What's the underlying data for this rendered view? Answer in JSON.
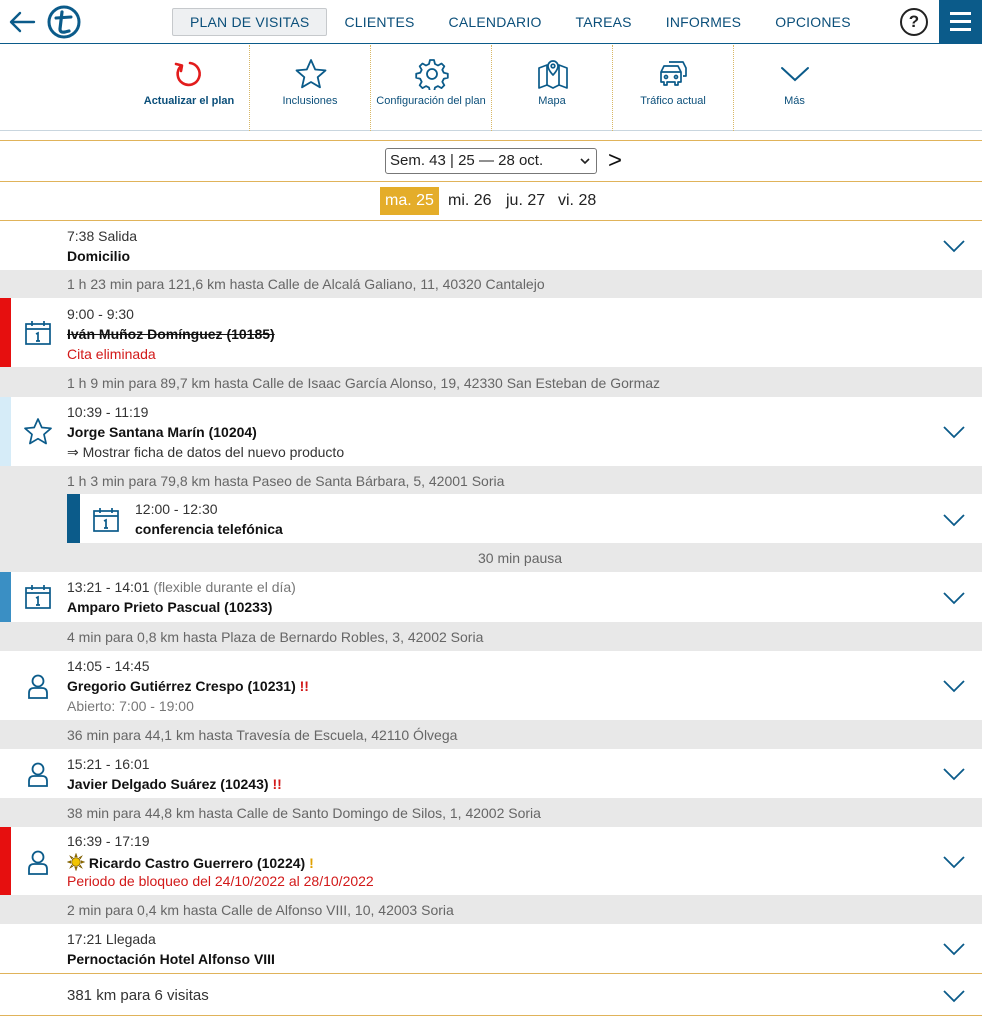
{
  "nav": {
    "items": [
      "PLAN DE VISITAS",
      "CLIENTES",
      "CALENDARIO",
      "TAREAS",
      "INFORMES",
      "OPCIONES"
    ],
    "help": "?"
  },
  "toolbar": {
    "items": [
      "Actualizar el plan",
      "Inclusiones",
      "Configuración del plan",
      "Mapa",
      "Tráfico actual",
      "Más"
    ]
  },
  "week": {
    "selected": "Sem. 43 | 25 — 28 oct.",
    "next": ">"
  },
  "days": [
    "ma. 25",
    "mi. 26",
    "ju. 27",
    "vi. 28"
  ],
  "colors": {
    "accent": "#0b5b8a",
    "highlight": "#e4ad2a",
    "alert": "#d21919",
    "calendar_bar": "#3a8fc4",
    "star_bar": "#d6ecf8"
  },
  "plan": {
    "departure_time": "7:38 Salida",
    "departure_place": "Domicilio",
    "travel1": "1 h 23 min para 121,6 km hasta Calle de Alcalá Galiano, 11, 40320 Cantalejo",
    "v1_time": "9:00 - 9:30",
    "v1_name": "Iván Muñoz Domínguez (10185)",
    "v1_note": "Cita eliminada",
    "travel2": "1 h 9 min para 89,7 km hasta Calle de Isaac García Alonso, 19, 42330 San Esteban de Gormaz",
    "v2_time": "10:39 - 11:19",
    "v2_name": "Jorge Santana Marín (10204)",
    "v2_note": "⇒ Mostrar ficha de datos del nuevo producto",
    "travel3": "1 h 3 min para 79,8 km hasta Paseo de Santa Bárbara, 5, 42001 Soria",
    "call_time": "12:00 - 12:30",
    "call_name": "conferencia telefónica",
    "pause": "30 min pausa",
    "v3_time": "13:21 - 14:01",
    "v3_flex": "(flexible durante el día)",
    "v3_name": "Amparo Prieto Pascual (10233)",
    "travel4": "4 min para 0,8 km hasta Plaza de Bernardo Robles, 3, 42002 Soria",
    "v4_time": "14:05 - 14:45",
    "v4_name": "Gregorio Gutiérrez Crespo (10231)",
    "v4_mark": "!!",
    "v4_note": "Abierto: 7:00 - 19:00",
    "travel5": "36 min para 44,1 km hasta Travesía de Escuela, 42110 Ólvega",
    "v5_time": "15:21 - 16:01",
    "v5_name": "Javier Delgado Suárez (10243)",
    "v5_mark": "!!",
    "travel6": "38 min para 44,8 km hasta Calle de Santo Domingo de Silos, 1, 42002 Soria",
    "v6_time": "16:39 - 17:19",
    "v6_name": "Ricardo Castro Guerrero (10224)",
    "v6_mark": "!",
    "v6_note": "Periodo de bloqueo del 24/10/2022 al 28/10/2022",
    "travel7": "2 min para 0,4 km hasta Calle de Alfonso VIII, 10, 42003 Soria",
    "arrival_time": "17:21 Llegada",
    "arrival_place": "Pernoctación Hotel Alfonso VIII",
    "summary": "381 km para 6 visitas"
  }
}
